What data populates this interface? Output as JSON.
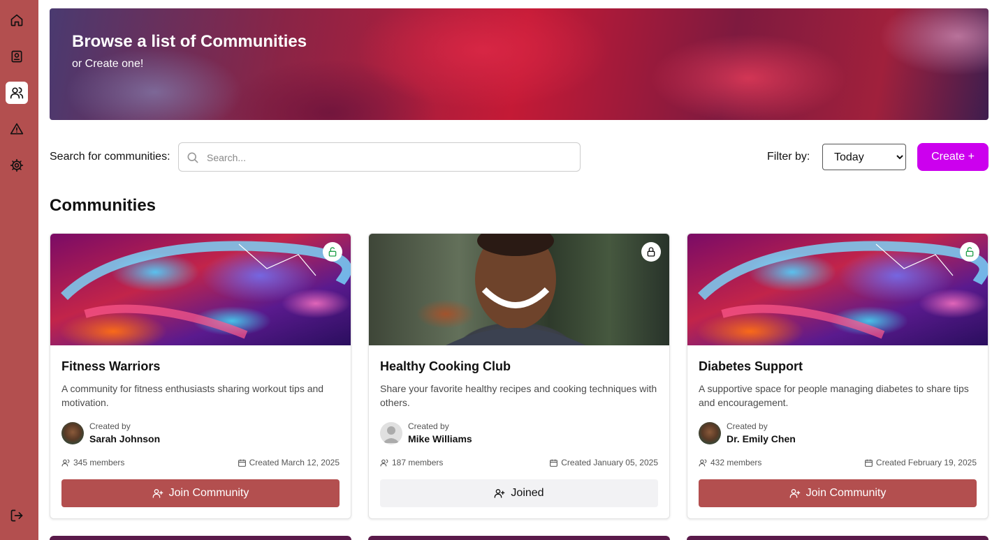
{
  "sidebar": {
    "items": [
      {
        "icon": "home-icon",
        "active": false
      },
      {
        "icon": "journal-icon",
        "active": false
      },
      {
        "icon": "users-icon",
        "active": true
      },
      {
        "icon": "warning-icon",
        "active": false
      },
      {
        "icon": "gear-icon",
        "active": false
      }
    ],
    "logout_icon": "logout-icon"
  },
  "hero": {
    "title": "Browse a list of Communities",
    "subtitle": "or Create one!"
  },
  "search": {
    "label": "Search for communities:",
    "placeholder": "Search...",
    "value": ""
  },
  "filter": {
    "label": "Filter by:",
    "selected": "Today",
    "options": [
      "Today"
    ]
  },
  "create_button": "Create +",
  "section_title": "Communities",
  "colors": {
    "sidebar": "#b34f4f",
    "join_button": "#b34f4f",
    "create_button": "#cc00ee",
    "unlock_icon": "#22a04a"
  },
  "communities": [
    {
      "name": "Fitness Warriors",
      "description": "A community for fitness enthusiasts sharing workout tips and motivation.",
      "created_by_label": "Created by",
      "author": "Sarah Johnson",
      "members": "345 members",
      "created": "Created March 12, 2025",
      "button": "Join Community",
      "locked": false
    },
    {
      "name": "Healthy Cooking Club",
      "description": "Share your favorite healthy recipes and cooking techniques with others.",
      "created_by_label": "Created by",
      "author": "Mike Williams",
      "members": "187 members",
      "created": "Created January 05, 2025",
      "button": "Joined",
      "locked": true
    },
    {
      "name": "Diabetes Support",
      "description": "A supportive space for people managing diabetes to share tips and encouragement.",
      "created_by_label": "Created by",
      "author": "Dr. Emily Chen",
      "members": "432 members",
      "created": "Created February 19, 2025",
      "button": "Join Community",
      "locked": false
    }
  ]
}
